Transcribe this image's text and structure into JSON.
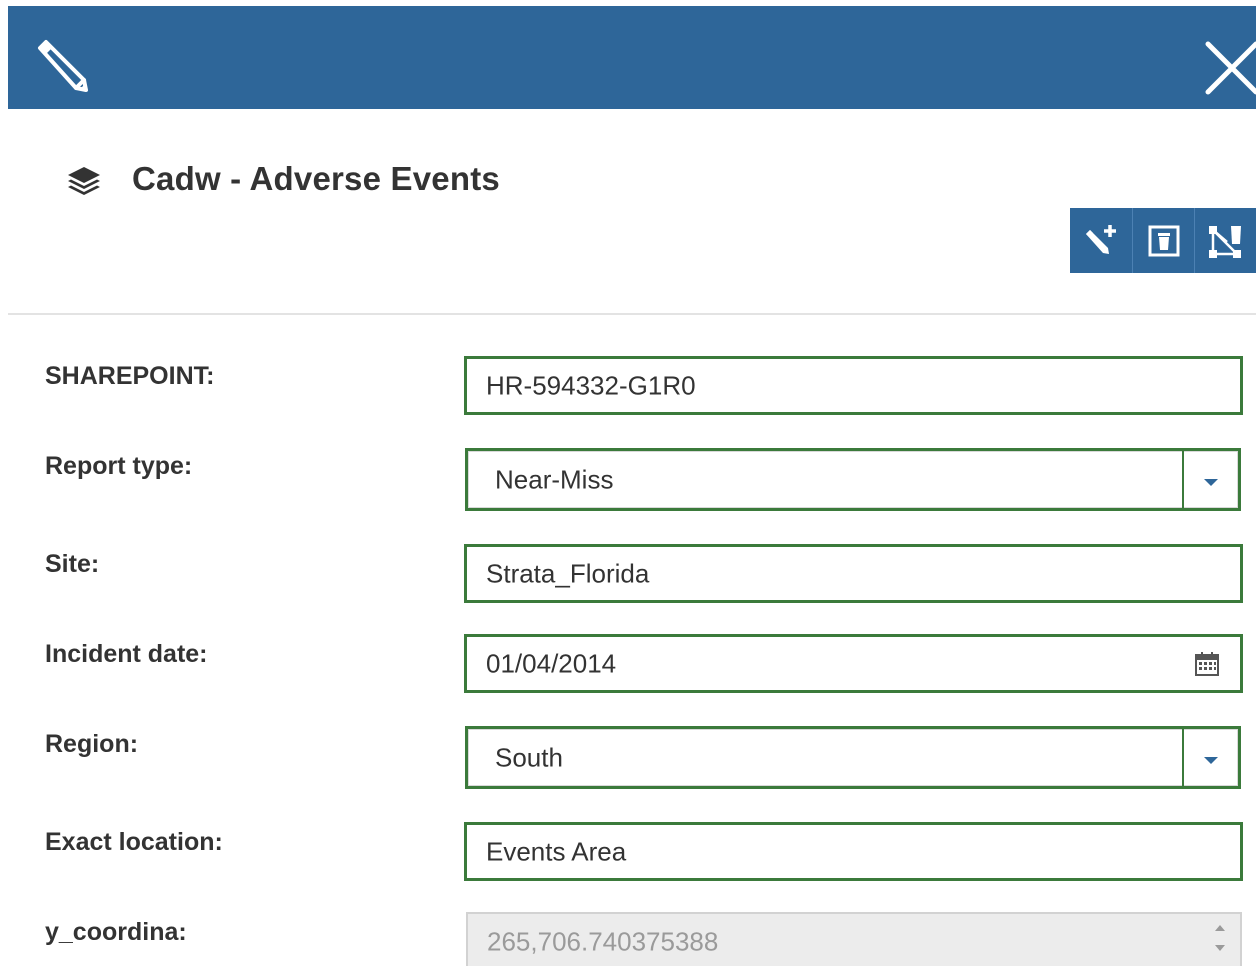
{
  "header": {
    "edit_icon": "pencil-icon",
    "close_icon": "close-icon"
  },
  "layer": {
    "icon": "layers-icon",
    "title": "Cadw - Adverse Events"
  },
  "toolbar": {
    "buttons": [
      {
        "icon": "add-feature-icon"
      },
      {
        "icon": "delete-icon"
      },
      {
        "icon": "edit-geometry-icon"
      }
    ]
  },
  "colors": {
    "header_bg": "#2e6699",
    "field_border": "#3b7a3b",
    "disabled_bg": "#ececec"
  },
  "form": {
    "fields": [
      {
        "label": "SHAREPOINT:",
        "value": "HR-594332-G1R0",
        "type": "text"
      },
      {
        "label": "Report type:",
        "value": "Near-Miss",
        "type": "select"
      },
      {
        "label": "Site:",
        "value": "Strata_Florida",
        "type": "text"
      },
      {
        "label": "Incident date:",
        "value": "01/04/2014",
        "type": "date"
      },
      {
        "label": "Region:",
        "value": "South",
        "type": "select"
      },
      {
        "label": "Exact location:",
        "value": "Events Area",
        "type": "text"
      },
      {
        "label": "y_coordina:",
        "value": "265,706.740375388",
        "type": "number-disabled"
      }
    ]
  }
}
